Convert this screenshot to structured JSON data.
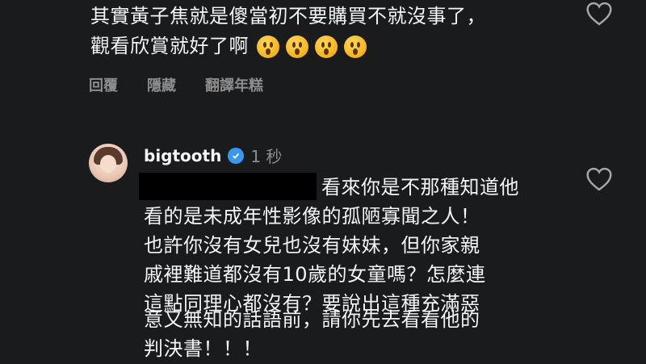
{
  "comment1": {
    "lines": [
      "其實黃子焦就是傻當初不要購買不就沒事了，",
      "觀看欣賞就好了啊"
    ],
    "emoji_count": 4
  },
  "actions": {
    "reply": "回覆",
    "hide": "隱藏",
    "translate": "翻譯年糕"
  },
  "reply": {
    "username": "bigtooth",
    "timestamp": "1 秒",
    "lines": [
      "看來你是不那種知道他",
      "看的是未成年性影像的孤陋寡聞之人！",
      "也許你沒有女兒也沒有妹妹，但你家親",
      "戚裡難道都沒有10歲的女童嗎？怎麼連",
      "這點同理心都沒有？要說出這種充滿惡",
      "意又無知的話語前，請你先去看看他的",
      "判決書！！！"
    ]
  },
  "icons": {
    "like_1": "heart-icon",
    "like_2": "heart-icon",
    "verified": "verified-badge-icon"
  },
  "colors": {
    "background": "#1a1b1d",
    "text": "#f4f4f4",
    "muted": "#8e8e8e",
    "verified": "#3897f0"
  }
}
